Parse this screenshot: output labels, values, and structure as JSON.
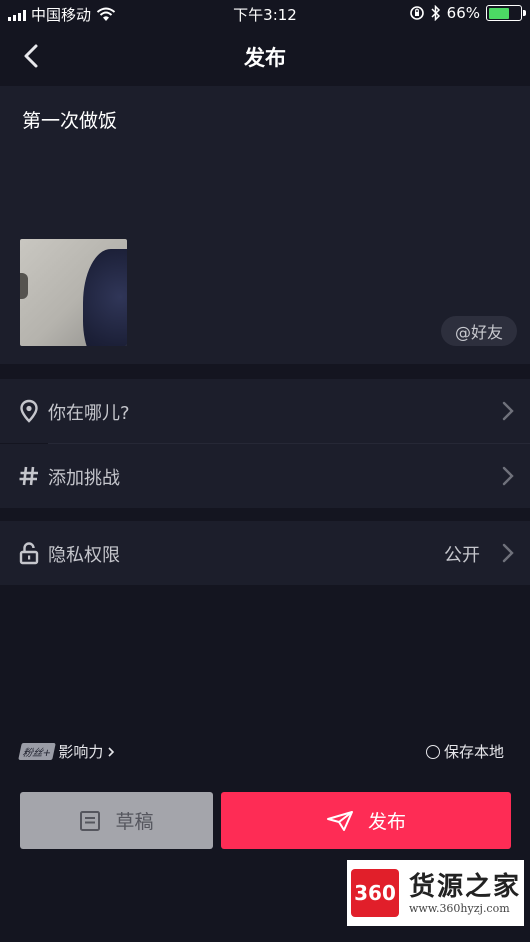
{
  "status_bar": {
    "carrier": "中国移动",
    "time": "下午3:12",
    "battery_percent": "66%",
    "battery_level": 0.66
  },
  "navbar": {
    "back_icon": "chevron-left-icon",
    "title": "发布"
  },
  "compose": {
    "caption": "第一次做饭",
    "mention_label": "@好友"
  },
  "options": [
    {
      "icon": "location-pin-icon",
      "label": "你在哪儿?"
    },
    {
      "icon": "hashtag-icon",
      "label": "添加挑战"
    }
  ],
  "privacy": {
    "icon": "unlock-icon",
    "label": "隐私权限",
    "value": "公开"
  },
  "footer": {
    "fans_badge": "粉丝+",
    "influence_label": "影响力",
    "save_local_label": "保存本地",
    "draft_label": "草稿",
    "publish_label": "发布"
  },
  "watermark": {
    "number": "360",
    "brand": "货源之家",
    "url": "www.360hyzj.com"
  },
  "colors": {
    "background": "#141520",
    "panel": "#1c1e2b",
    "publish_button": "#fe2c55",
    "draft_button": "#a4a5ab"
  }
}
